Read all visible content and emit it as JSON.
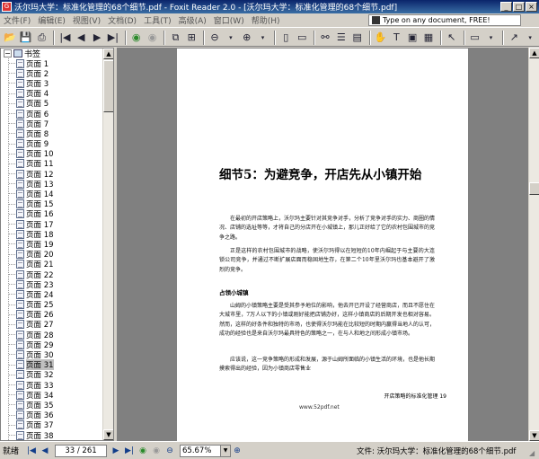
{
  "window": {
    "title": "沃尔玛大学：标准化管理的68个细节.pdf - Foxit Reader 2.0 - [沃尔玛大学：标准化管理的68个细节.pdf]",
    "minimize": "_",
    "maximize": "□",
    "close": "×"
  },
  "menu": {
    "items": [
      "文件(F)",
      "编辑(E)",
      "视图(V)",
      "文档(D)",
      "工具(T)",
      "高级(A)",
      "窗口(W)",
      "帮助(H)"
    ],
    "promo": "Type on any document, FREE!"
  },
  "bookmarks": {
    "root_label": "书签",
    "items": [
      "页面 1",
      "页面 2",
      "页面 3",
      "页面 4",
      "页面 5",
      "页面 6",
      "页面 7",
      "页面 8",
      "页面 9",
      "页面 10",
      "页面 11",
      "页面 12",
      "页面 13",
      "页面 14",
      "页面 15",
      "页面 16",
      "页面 17",
      "页面 18",
      "页面 19",
      "页面 20",
      "页面 21",
      "页面 22",
      "页面 23",
      "页面 24",
      "页面 25",
      "页面 26",
      "页面 27",
      "页面 28",
      "页面 29",
      "页面 30",
      "页面 31",
      "页面 32",
      "页面 33",
      "页面 34",
      "页面 35",
      "页面 36",
      "页面 37",
      "页面 38"
    ],
    "selected": "页面 31"
  },
  "document": {
    "chapter_title": "细节5：为避竞争，开店先从小镇开始",
    "para1": "在最初的开店策略上，沃尔玛主要针对其竞争对手，分析了竞争对手的实力、商圈的情况、店铺的选址等等，才将自己的分店开在小城镇上，那儿正好给了它的农村包围城市的竞争之路。",
    "para2": "正是这样的农村包围城市的战略，使沃尔玛得以在短短的10年内崛起于与主要的大连锁公司竞争，并通过不断扩展店面而稳固地生存，在第二个10年里沃尔玛也基本避开了激烈的竞争。",
    "section_head": "占领小城镇",
    "para3": "山姆的小镇策略主要是受其参予地位的影响，他去开已开设了经营商店，而且不愿住在大城市里，7万人以下的小镇或刚好能把店铺办好，这样小镇商店的后期开发也相对容易。然而，这样的好条件和独特的市场，也使得沃尔玛能在比较短的时期内赢得当地人的认可，成功的经验也是来自沃尔玛最具特色的策略之一，在与人和地之间形成小镇市场。",
    "para4": "应该说，这一竞争策略的形成和发展，源于山姆所面临的小镇生活的环境，也是他长期摸索得出的经验，因为小镇商店零售业",
    "footer": "开店策略的标准化管理    19",
    "watermark": "www.52pdf.net"
  },
  "status": {
    "ready": "就绪",
    "page_indicator": "33 / 261",
    "zoom": "65.67%",
    "file_label": "文件: 沃尔玛大学：标准化管理的68个细节.pdf"
  },
  "colors": {
    "titlebar": "#0a246a",
    "window_bg": "#d4d0c8",
    "doc_bg": "#808080",
    "nav_blue": "#123d8a"
  }
}
